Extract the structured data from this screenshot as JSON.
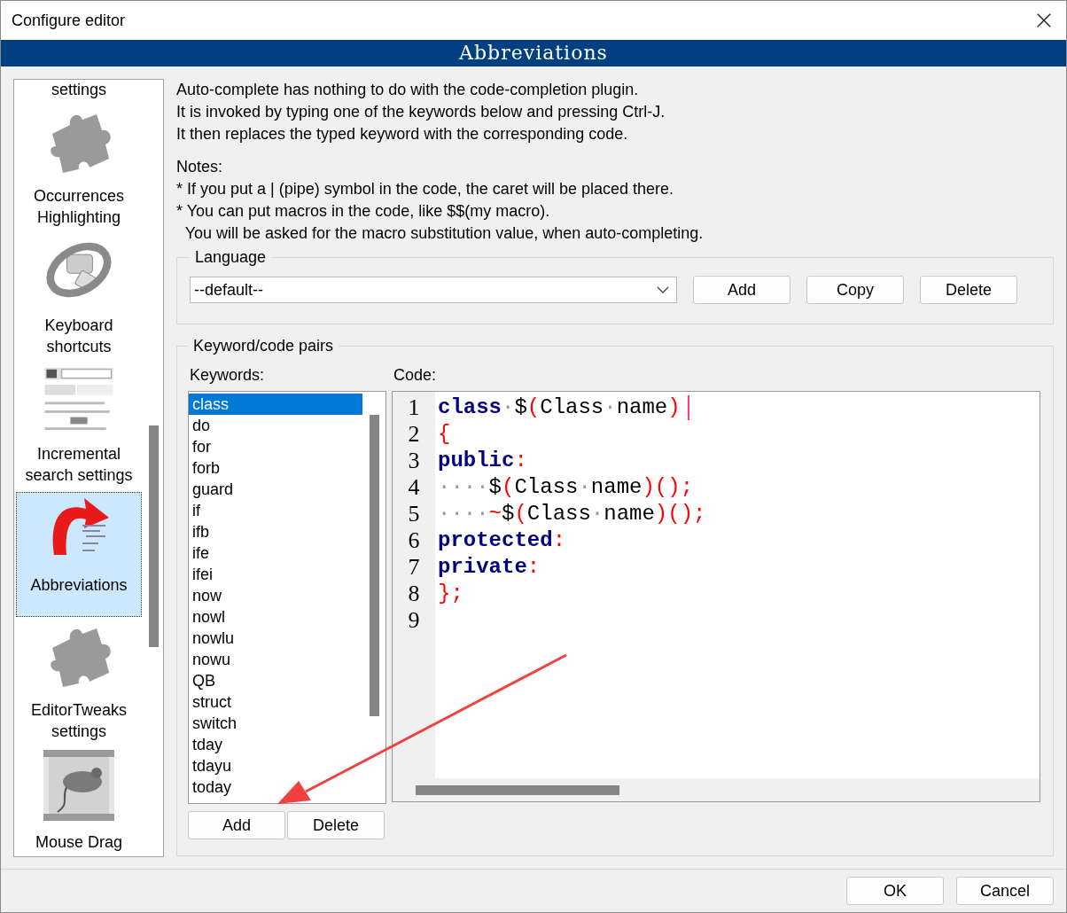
{
  "window": {
    "title": "Configure editor"
  },
  "header": {
    "title": "Abbreviations"
  },
  "sidebar": {
    "items": [
      {
        "label": "settings",
        "kind": "none",
        "selected": false
      },
      {
        "label": "Occurrences Highlighting",
        "kind": "puzzle",
        "selected": false
      },
      {
        "label": "Keyboard shortcuts",
        "kind": "ring",
        "selected": false
      },
      {
        "label": "Incremental search settings",
        "kind": "screen",
        "selected": false
      },
      {
        "label": "Abbreviations",
        "kind": "arrow",
        "selected": true
      },
      {
        "label": "EditorTweaks settings",
        "kind": "puzzle",
        "selected": false
      },
      {
        "label": "Mouse Drag",
        "kind": "scroll",
        "selected": false
      }
    ]
  },
  "description": [
    "Auto-complete has nothing to do with the code-completion plugin.",
    "It is invoked by typing one of the keywords below and pressing Ctrl-J.",
    "It then replaces the typed keyword with the corresponding code."
  ],
  "notes": {
    "title": "Notes:",
    "lines": [
      "* If you put a | (pipe) symbol in the code, the caret will be placed there.",
      "* You can put macros in the code, like $$(my macro).",
      "  You will be asked for the macro substitution value, when auto-completing."
    ]
  },
  "language": {
    "label": "Language",
    "value": "--default--",
    "buttons": [
      "Add",
      "Copy",
      "Delete"
    ]
  },
  "pairs": {
    "label": "Keyword/code pairs",
    "keywords_label": "Keywords:",
    "code_label": "Code:",
    "keywords": [
      {
        "label": "class",
        "selected": true
      },
      {
        "label": "do",
        "selected": false
      },
      {
        "label": "for",
        "selected": false
      },
      {
        "label": "forb",
        "selected": false
      },
      {
        "label": "guard",
        "selected": false
      },
      {
        "label": "if",
        "selected": false
      },
      {
        "label": "ifb",
        "selected": false
      },
      {
        "label": "ife",
        "selected": false
      },
      {
        "label": "ifei",
        "selected": false
      },
      {
        "label": "now",
        "selected": false
      },
      {
        "label": "nowl",
        "selected": false
      },
      {
        "label": "nowlu",
        "selected": false
      },
      {
        "label": "nowu",
        "selected": false
      },
      {
        "label": "QB",
        "selected": false
      },
      {
        "label": "struct",
        "selected": false
      },
      {
        "label": "switch",
        "selected": false
      },
      {
        "label": "tday",
        "selected": false
      },
      {
        "label": "tdayu",
        "selected": false
      },
      {
        "label": "today",
        "selected": false
      }
    ],
    "buttons": [
      "Add",
      "Delete"
    ],
    "code_lines": [
      {
        "number": "1",
        "caret": true,
        "tokens": [
          {
            "kind": "keyword",
            "text": "class"
          },
          {
            "kind": "space",
            "text": "·"
          },
          {
            "kind": "plain",
            "text": "$"
          },
          {
            "kind": "punct",
            "text": "("
          },
          {
            "kind": "plain",
            "text": "Class"
          },
          {
            "kind": "space",
            "text": "·"
          },
          {
            "kind": "plain",
            "text": "name"
          },
          {
            "kind": "punct",
            "text": ")"
          }
        ]
      },
      {
        "number": "2",
        "caret": false,
        "tokens": [
          {
            "kind": "punct",
            "text": "{"
          }
        ]
      },
      {
        "number": "3",
        "caret": false,
        "tokens": [
          {
            "kind": "keyword",
            "text": "public"
          },
          {
            "kind": "punct",
            "text": ":"
          }
        ]
      },
      {
        "number": "4",
        "caret": false,
        "tokens": [
          {
            "kind": "space",
            "text": "····"
          },
          {
            "kind": "plain",
            "text": "$"
          },
          {
            "kind": "punct",
            "text": "("
          },
          {
            "kind": "plain",
            "text": "Class"
          },
          {
            "kind": "space",
            "text": "·"
          },
          {
            "kind": "plain",
            "text": "name"
          },
          {
            "kind": "punct",
            "text": ")();"
          }
        ]
      },
      {
        "number": "5",
        "caret": false,
        "tokens": [
          {
            "kind": "space",
            "text": "····"
          },
          {
            "kind": "punct",
            "text": "~"
          },
          {
            "kind": "plain",
            "text": "$"
          },
          {
            "kind": "punct",
            "text": "("
          },
          {
            "kind": "plain",
            "text": "Class"
          },
          {
            "kind": "space",
            "text": "·"
          },
          {
            "kind": "plain",
            "text": "name"
          },
          {
            "kind": "punct",
            "text": ")();"
          }
        ]
      },
      {
        "number": "6",
        "caret": false,
        "tokens": [
          {
            "kind": "keyword",
            "text": "protected"
          },
          {
            "kind": "punct",
            "text": ":"
          }
        ]
      },
      {
        "number": "7",
        "caret": false,
        "tokens": [
          {
            "kind": "keyword",
            "text": "private"
          },
          {
            "kind": "punct",
            "text": ":"
          }
        ]
      },
      {
        "number": "8",
        "caret": false,
        "tokens": [
          {
            "kind": "punct",
            "text": "};"
          }
        ]
      },
      {
        "number": "9",
        "caret": false
      }
    ]
  },
  "buttons": [
    "OK",
    "Cancel"
  ]
}
